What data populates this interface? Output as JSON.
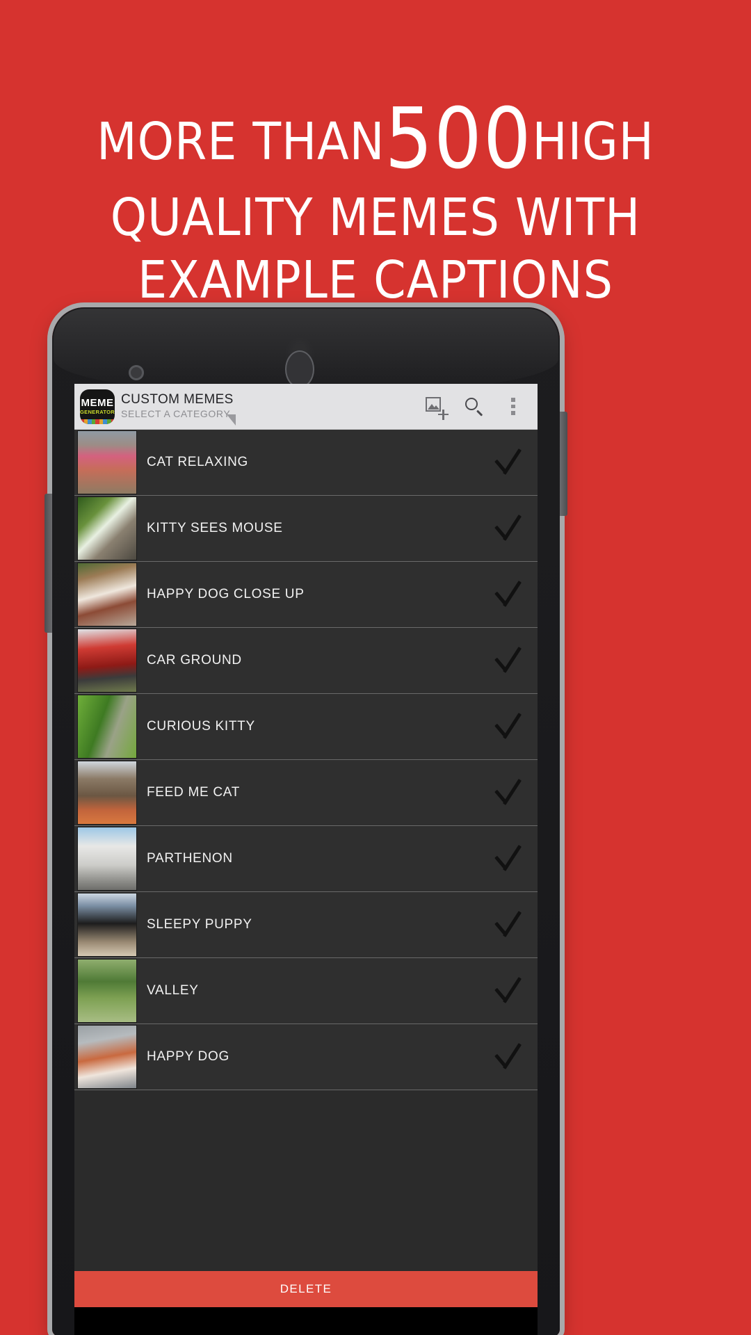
{
  "promo": {
    "background_color": "#d6332f",
    "headline_lines": [
      {
        "pre": "MORE THAN ",
        "big": "500",
        "post": " HIGH"
      },
      {
        "text": "QUALITY MEMES WITH"
      },
      {
        "text": "EXAMPLE CAPTIONS"
      }
    ],
    "line1_pre": "MORE THAN",
    "line1_big": "500",
    "line1_post": "HIGH",
    "line2": "QUALITY MEMES WITH",
    "line3": "EXAMPLE CAPTIONS"
  },
  "app": {
    "logo": {
      "primary_text": "MEME",
      "secondary_text": "GENERATOR",
      "primary_color": "#ffffff",
      "secondary_color": "#c8d92b",
      "background_color": "#151515",
      "stripe_colors": [
        "#d63b33",
        "#e2a32c",
        "#3d8fd1",
        "#5aa832",
        "#d63b33",
        "#e2a32c",
        "#3d8fd1",
        "#5aa832",
        "#d63b33"
      ]
    },
    "toolbar": {
      "title": "CUSTOM MEMES",
      "subtitle": "SELECT A CATEGORY",
      "background_color": "#e2e2e4",
      "actions": [
        {
          "name": "add-image-icon",
          "label": "Add image"
        },
        {
          "name": "search-icon",
          "label": "Search"
        },
        {
          "name": "overflow-menu-icon",
          "label": "More options"
        }
      ]
    },
    "list": {
      "background_color": "#2f2f2f",
      "checkmark_color": "#111111",
      "items": [
        {
          "label": "CAT RELAXING",
          "checked": true,
          "thumb_class": "t-cat-relaxing"
        },
        {
          "label": "KITTY SEES MOUSE",
          "checked": true,
          "thumb_class": "t-kitty-mouse"
        },
        {
          "label": "HAPPY DOG CLOSE UP",
          "checked": true,
          "thumb_class": "t-happy-dog-cu"
        },
        {
          "label": "CAR GROUND",
          "checked": true,
          "thumb_class": "t-car-ground"
        },
        {
          "label": "CURIOUS KITTY",
          "checked": true,
          "thumb_class": "t-curious-kitty"
        },
        {
          "label": "FEED ME CAT",
          "checked": true,
          "thumb_class": "t-feed-me-cat"
        },
        {
          "label": "PARTHENON",
          "checked": true,
          "thumb_class": "t-parthenon"
        },
        {
          "label": "SLEEPY PUPPY",
          "checked": true,
          "thumb_class": "t-sleepy-puppy"
        },
        {
          "label": "VALLEY",
          "checked": true,
          "thumb_class": "t-valley"
        },
        {
          "label": "HAPPY DOG",
          "checked": true,
          "thumb_class": "t-happy-dog"
        }
      ]
    },
    "delete_button": {
      "label": "DELETE",
      "background_color": "#dd4b3e",
      "text_color": "#ffffff"
    }
  }
}
